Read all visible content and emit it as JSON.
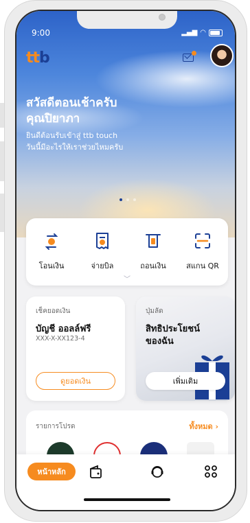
{
  "status": {
    "time": "9:00"
  },
  "brand": {
    "logo_ttb_orange": "tt",
    "logo_ttb_blue": "b",
    "orange": "#f68b1f",
    "navy": "#1b3f95"
  },
  "header": {
    "greeting_line1": "สวัสดีตอนเช้าครับ",
    "greeting_line2": "คุณปิยาภา",
    "sub_line1": "ยินดีต้อนรับเข้าสู่ ttb touch",
    "sub_line2": "วันนี้มีอะไรให้เราช่วยไหมครับ"
  },
  "carousel": {
    "active_index": 0,
    "count": 3
  },
  "quick_actions": [
    {
      "label": "โอนเงิน",
      "icon": "transfer-icon"
    },
    {
      "label": "จ่ายบิล",
      "icon": "bill-icon"
    },
    {
      "label": "ถอนเงิน",
      "icon": "withdraw-icon"
    },
    {
      "label": "สแกน QR",
      "icon": "scan-qr-icon"
    }
  ],
  "balance_card": {
    "caption": "เช็คยอดเงิน",
    "title": "บัญชี ออลล์ฟรี",
    "account": "XXX-X-XX123-4",
    "button": "ดูยอดเงิน"
  },
  "privilege_card": {
    "caption": "ปุ่มลัด",
    "title_line1": "สิทธิประโยชน์",
    "title_line2": "ของฉัน",
    "button": "เพิ่มเติม"
  },
  "promotions": {
    "title": "รายการโปรด",
    "see_all": "ทั้งหมด"
  },
  "tabbar": {
    "home_label": "หน้าหลัก"
  }
}
